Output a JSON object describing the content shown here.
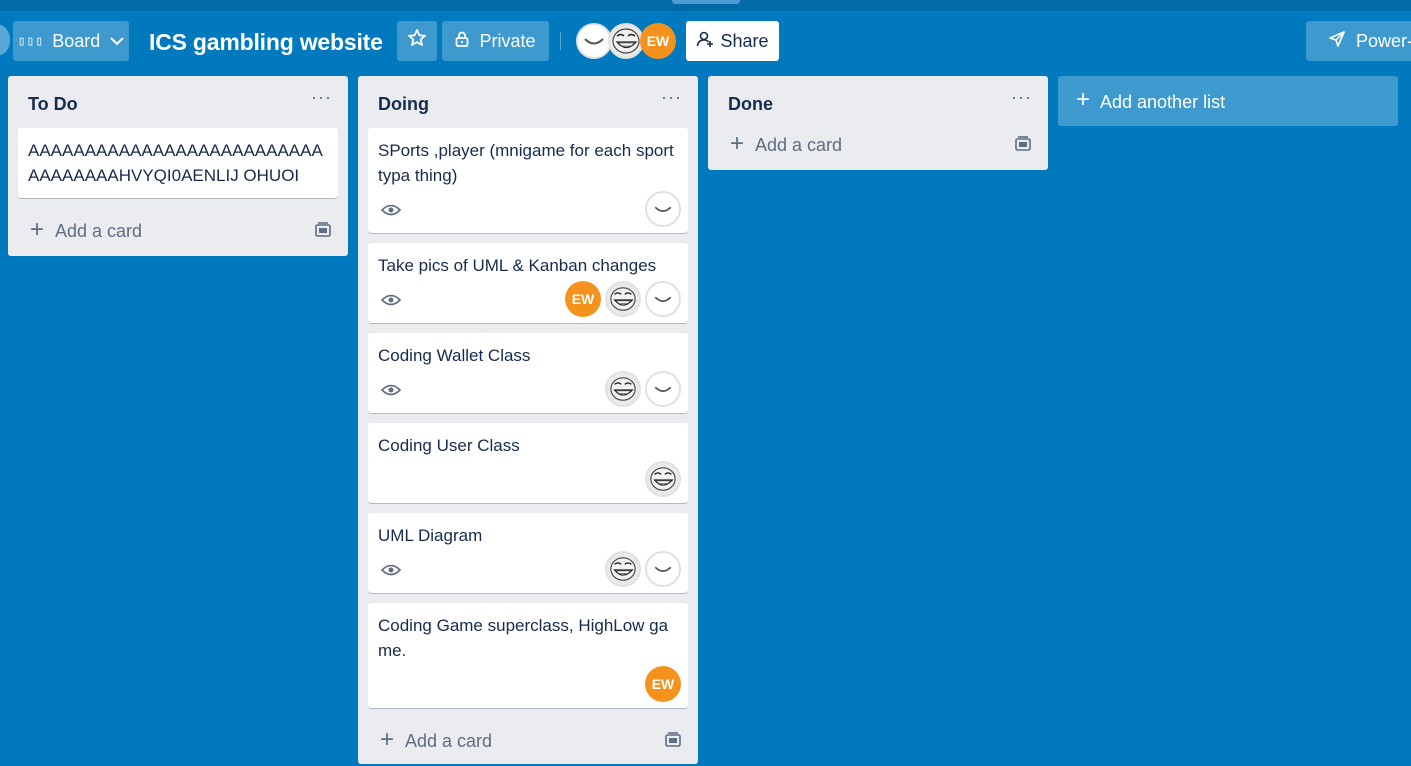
{
  "header": {
    "board_button_label": "Board",
    "board_title": "ICS gambling website",
    "private_label": "Private",
    "share_label": "Share",
    "power_label": "Power-",
    "members": [
      "smile-avatar",
      "troll-avatar",
      "EW"
    ]
  },
  "lists": [
    {
      "title": "To Do",
      "menu": "···",
      "cards": [
        {
          "text": "AAAAAAAAAAAAAAAAAAAAAAAAAAAAAAAAAAHVYQI0AENLIJ OHUOI"
        }
      ],
      "add_card_label": "Add a card"
    },
    {
      "title": "Doing",
      "menu": "···",
      "cards": [
        {
          "text": "SPorts ,player (mnigame for each sport typa thing)",
          "watch": true,
          "members": [
            "smile-avatar"
          ]
        },
        {
          "text": "Take pics of UML & Kanban changes",
          "watch": true,
          "members": [
            "EW",
            "troll-avatar",
            "smile-avatar"
          ]
        },
        {
          "text": "Coding Wallet Class",
          "watch": true,
          "members": [
            "troll-avatar",
            "smile-avatar"
          ]
        },
        {
          "text": "Coding User Class",
          "watch": false,
          "members": [
            "troll-avatar"
          ]
        },
        {
          "text": "UML Diagram",
          "watch": true,
          "members": [
            "troll-avatar",
            "smile-avatar"
          ]
        },
        {
          "text": "Coding Game superclass, HighLow game.",
          "watch": false,
          "members": [
            "EW"
          ]
        }
      ],
      "add_card_label": "Add a card"
    },
    {
      "title": "Done",
      "menu": "···",
      "cards": [],
      "add_card_label": "Add a card"
    }
  ],
  "add_list_label": "Add another list",
  "colors": {
    "background": "#0079bf",
    "list_background": "#ebecf0",
    "avatar_ew": "#f5921d"
  }
}
